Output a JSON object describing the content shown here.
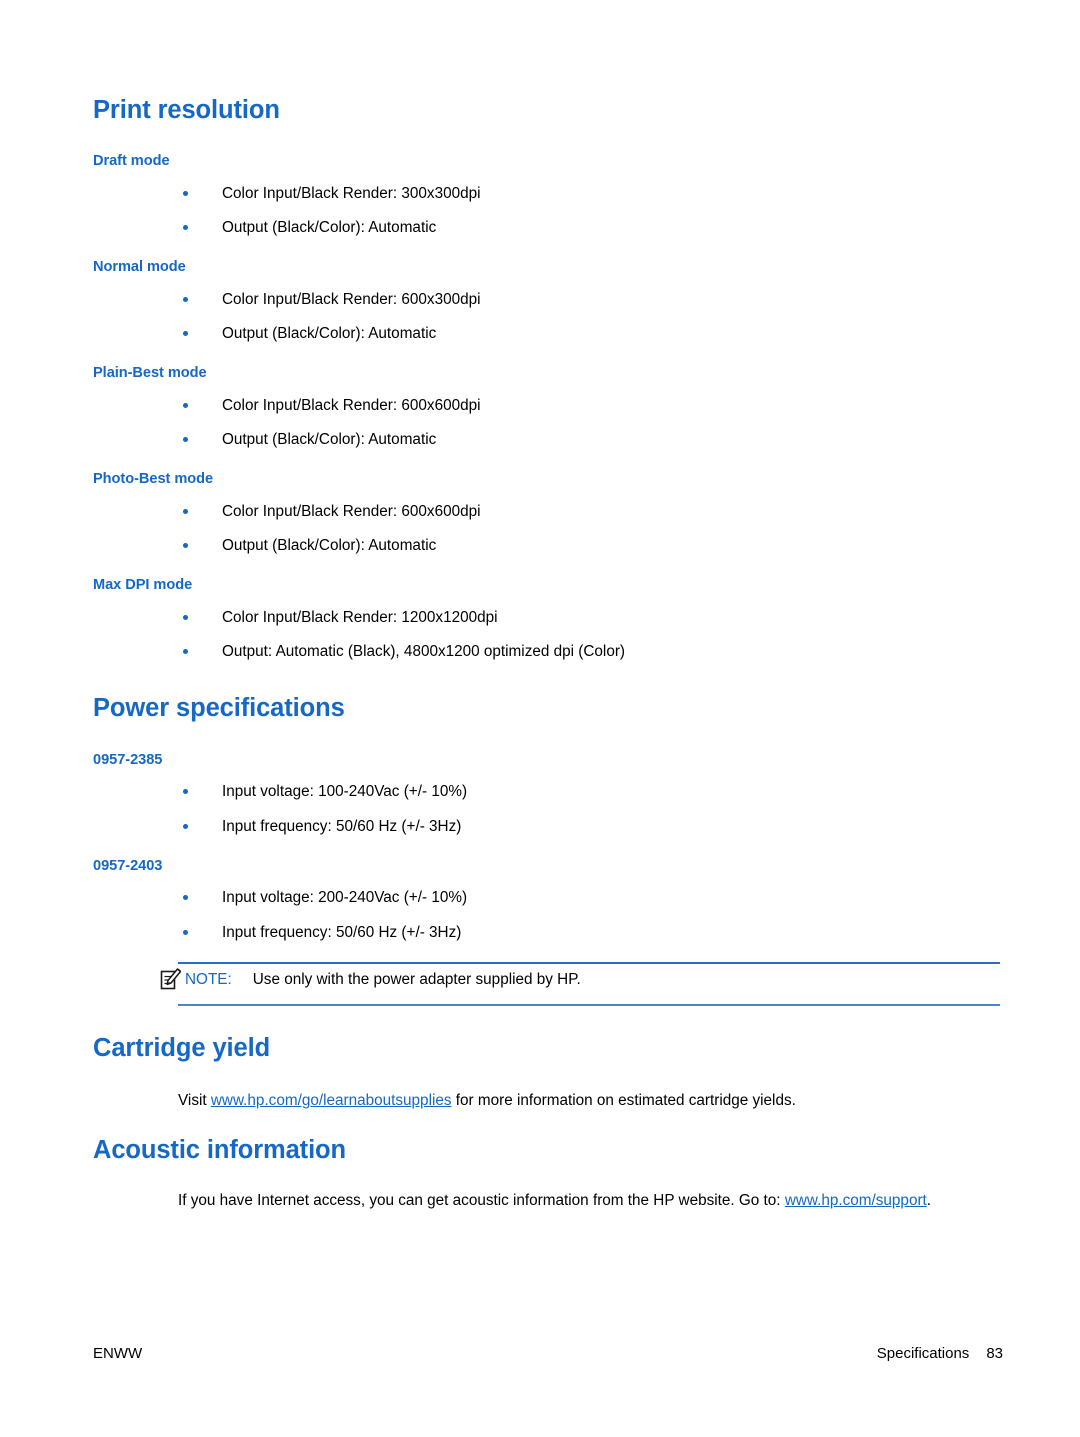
{
  "document": {
    "page_number": "83",
    "footer_left": "ENWW",
    "footer_right_label": "Specifications"
  },
  "sections": [
    {
      "title": "Print resolution",
      "groups": [
        {
          "label": "Draft mode",
          "items": [
            "Color Input/Black Render: 300x300dpi",
            "Output (Black/Color): Automatic"
          ]
        },
        {
          "label": "Normal mode",
          "items": [
            "Color Input/Black Render: 600x300dpi",
            "Output (Black/Color): Automatic"
          ]
        },
        {
          "label": "Plain-Best mode",
          "items": [
            "Color Input/Black Render: 600x600dpi",
            "Output (Black/Color): Automatic"
          ]
        },
        {
          "label": "Photo-Best mode",
          "items": [
            "Color Input/Black Render: 600x600dpi",
            "Output (Black/Color): Automatic"
          ]
        },
        {
          "label": "Max DPI mode",
          "items": [
            "Color Input/Black Render: 1200x1200dpi",
            "Output: Automatic (Black), 4800x1200 optimized dpi (Color)"
          ]
        }
      ]
    },
    {
      "title": "Power specifications",
      "groups": [
        {
          "label": "0957-2385",
          "items": [
            "Input voltage: 100-240Vac (+/- 10%)",
            "Input frequency: 50/60 Hz (+/- 3Hz)"
          ]
        },
        {
          "label": "0957-2403",
          "items": [
            "Input voltage: 200-240Vac (+/- 10%)",
            "Input frequency: 50/60 Hz (+/- 3Hz)"
          ]
        }
      ]
    },
    {
      "title": "Cartridge yield"
    },
    {
      "title": "Acoustic information"
    }
  ],
  "note": {
    "icon": "note-pencil-icon",
    "label": "NOTE:",
    "text": "Use only with the power adapter supplied by HP."
  },
  "cartridge_yield": {
    "text_before": "Visit ",
    "link": "www.hp.com/go/learnaboutsupplies",
    "text_after": " for more information on estimated cartridge yields."
  },
  "acoustic_information": {
    "text_before": "If you have Internet access, you can get acoustic information from the HP website. Go to: ",
    "link": "www.hp.com/support",
    "text_after": "."
  },
  "colors": {
    "heading_blue": "#1568C6",
    "link_blue": "#1568C6",
    "bullet_blue": "#1568C6",
    "note_rule_blue": "#2B6FC4",
    "body_black": "#000000",
    "page_background": "#FFFFFF"
  }
}
